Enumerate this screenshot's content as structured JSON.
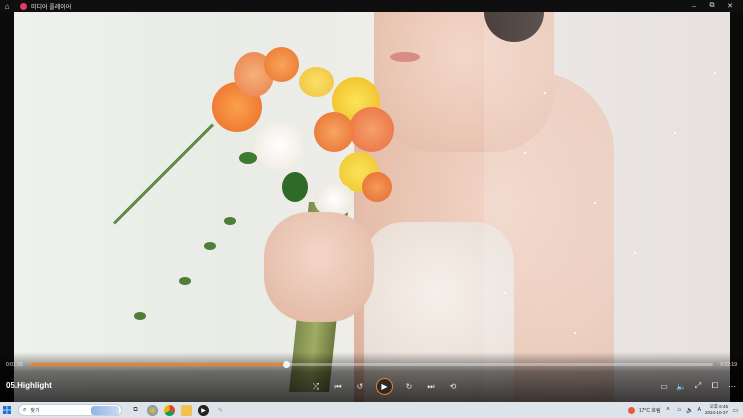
{
  "window": {
    "title": "미디어 플레이어",
    "minimize_icon": "minimize-icon",
    "maximize_icon": "restore-icon",
    "close_icon": "close-icon"
  },
  "player": {
    "current_time": "0:01:33",
    "total_time": "0:02:19",
    "progress": 0.375,
    "clip_title": "05.Highlight",
    "accent_color": "#e8822e",
    "controls": [
      "shuffle-icon",
      "previous-icon",
      "rewind-10-icon",
      "play-icon",
      "forward-30-icon",
      "next-icon",
      "repeat-off-icon"
    ],
    "right_controls": [
      "captions-icon",
      "volume-icon",
      "fullscreen-icon",
      "cast-icon",
      "more-icon"
    ]
  },
  "taskbar": {
    "search_label": "찾기",
    "weather": "17°C 흐림",
    "input_lang": "A",
    "time": "오후 6:45",
    "date": "2024-10-27"
  }
}
